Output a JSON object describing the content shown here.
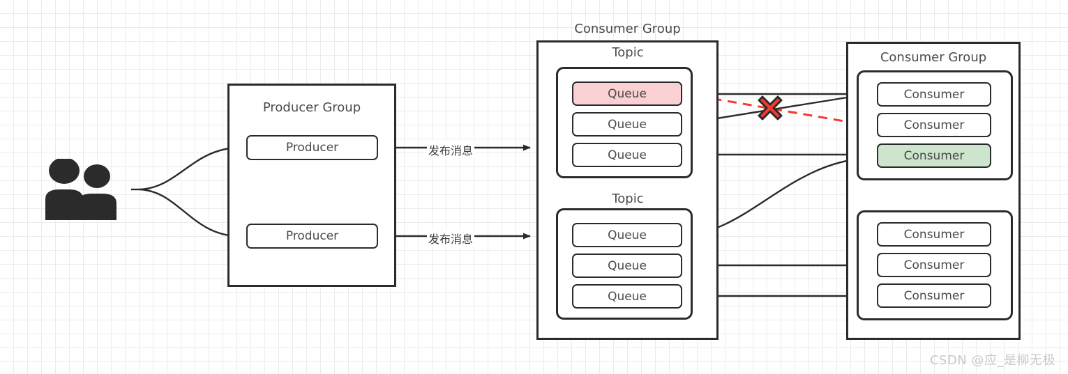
{
  "diagram": {
    "title": "RocketMQ producer consumer topology",
    "watermark": "CSDN @应_是柳无极",
    "colors": {
      "stroke": "#2b2b2b",
      "text": "#4a4a4a",
      "pink_fill": "#fad0d3",
      "green_fill": "#cce5cc",
      "red_accent": "#f4392d",
      "grid": "#ebebeb",
      "watermark": "#c9c9c9"
    },
    "actors": {
      "users_icon": "users-icon"
    },
    "producer_group": {
      "title": "Producer Group",
      "producers": [
        {
          "label": "Producer"
        },
        {
          "label": "Producer"
        }
      ]
    },
    "broker": {
      "title": "Consumer Group",
      "topics": [
        {
          "title": "Topic",
          "queues": [
            {
              "label": "Queue",
              "state": "failed"
            },
            {
              "label": "Queue",
              "state": "normal"
            },
            {
              "label": "Queue",
              "state": "normal"
            }
          ]
        },
        {
          "title": "Topic",
          "queues": [
            {
              "label": "Queue",
              "state": "normal"
            },
            {
              "label": "Queue",
              "state": "normal"
            },
            {
              "label": "Queue",
              "state": "normal"
            }
          ]
        }
      ]
    },
    "consumer_group": {
      "title": "Consumer Group",
      "clusters": [
        {
          "consumers": [
            {
              "label": "Consumer",
              "state": "normal"
            },
            {
              "label": "Consumer",
              "state": "normal"
            },
            {
              "label": "Consumer",
              "state": "active"
            }
          ]
        },
        {
          "consumers": [
            {
              "label": "Consumer",
              "state": "normal"
            },
            {
              "label": "Consumer",
              "state": "normal"
            },
            {
              "label": "Consumer",
              "state": "normal"
            }
          ]
        }
      ]
    },
    "edge_labels": [
      {
        "text": "发布消息"
      },
      {
        "text": "发布消息"
      }
    ],
    "markers": [
      {
        "type": "red-cross",
        "meaning": "blocked-delivery"
      }
    ]
  }
}
